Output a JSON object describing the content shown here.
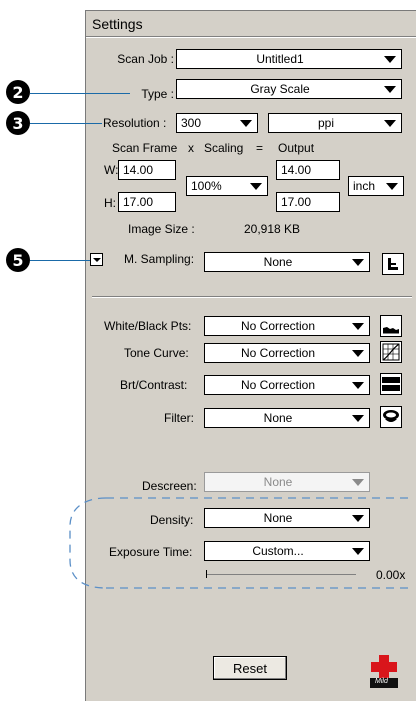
{
  "panel": {
    "title": "Settings"
  },
  "scan_job": {
    "label": "Scan Job :",
    "value": "Untitled1"
  },
  "type": {
    "label": "Type :",
    "value": "Gray Scale"
  },
  "resolution": {
    "label": "Resolution :",
    "value": "300",
    "unit": "ppi"
  },
  "scan_frame": {
    "header_scan": "Scan Frame",
    "header_x": "x",
    "header_scaling": "Scaling",
    "header_eq": "=",
    "header_output": "Output",
    "w_label": "W:",
    "h_label": "H:",
    "w_input": "14.00",
    "h_input": "17.00",
    "scaling": "100%",
    "w_output": "14.00",
    "h_output": "17.00",
    "unit": "inch"
  },
  "image_size": {
    "label": "Image Size :",
    "value": "20,918 KB"
  },
  "m_sampling": {
    "label": "M. Sampling:",
    "value": "None"
  },
  "callouts": [
    "2",
    "3",
    "5"
  ],
  "adjustments": {
    "white_black": {
      "label": "White/Black Pts:",
      "value": "No Correction"
    },
    "tone_curve": {
      "label": "Tone Curve:",
      "value": "No Correction"
    },
    "brt_contrast": {
      "label": "Brt/Contrast:",
      "value": "No Correction"
    },
    "filter": {
      "label": "Filter:",
      "value": "None"
    },
    "descreen": {
      "label": "Descreen:",
      "value": "None"
    }
  },
  "density": {
    "label": "Density:",
    "value": "None"
  },
  "exposure": {
    "label": "Exposure Time:",
    "value": "Custom...",
    "slider_value": "0.00x",
    "slider_fraction": 0
  },
  "buttons": {
    "reset": "Reset",
    "logo_text": "Mild"
  },
  "colors": {
    "panel_bg": "#d4d0c8",
    "callout_line": "#1a6aa8",
    "dashed_region": "#5b8fc7",
    "logo_red": "#d9151b"
  }
}
